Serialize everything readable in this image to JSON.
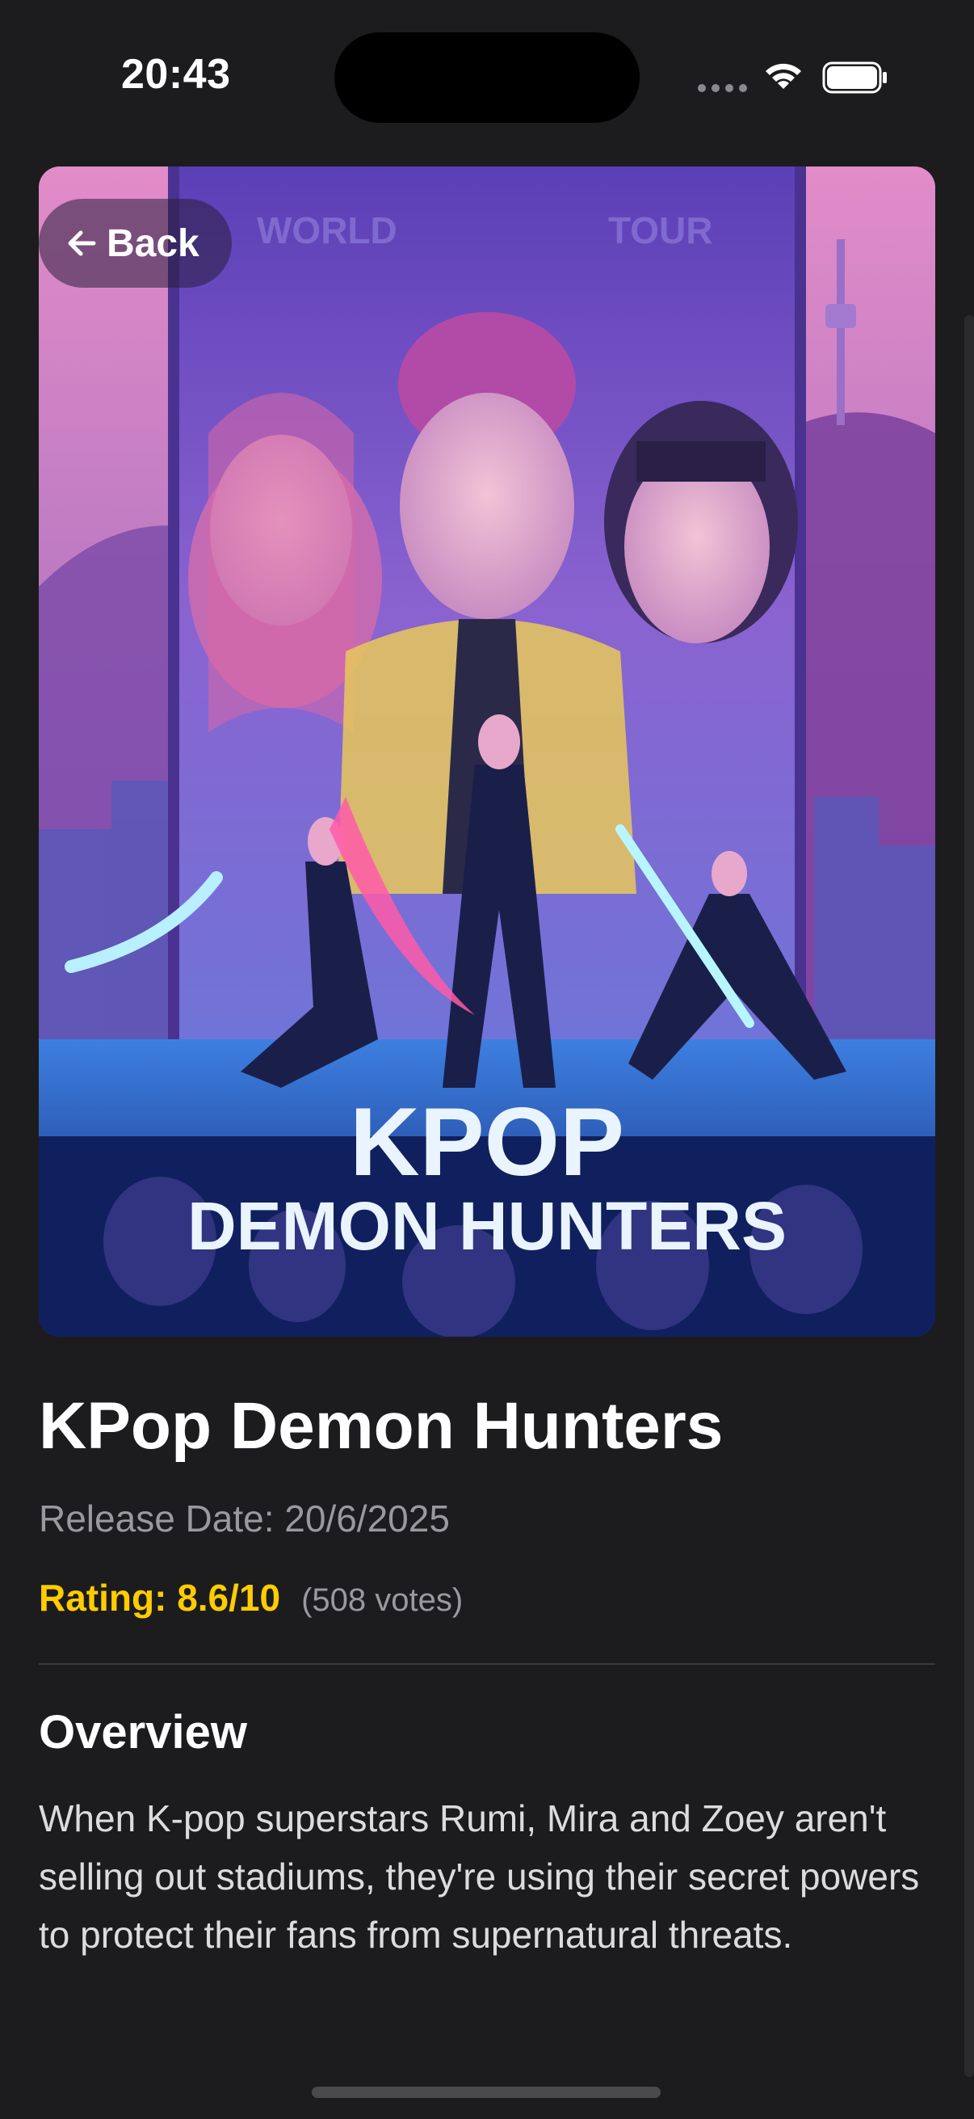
{
  "status_bar": {
    "time": "20:43",
    "wifi_icon": "wifi-icon",
    "battery_icon": "battery-full-icon",
    "signal_icon": "signal-dots-icon"
  },
  "navigation": {
    "back_label": "Back",
    "back_icon": "arrow-left-icon"
  },
  "poster": {
    "logo_line1": "KPOP",
    "logo_line2": "DEMON HUNTERS",
    "banner_left": "WORLD",
    "banner_right": "TOUR"
  },
  "movie": {
    "title": "KPop Demon Hunters",
    "release_date": "Release Date: 20/6/2025",
    "rating": "Rating: 8.6/10",
    "votes": "(508 votes)"
  },
  "overview": {
    "heading": "Overview",
    "text": "When K-pop superstars Rumi, Mira and Zoey aren't selling out stadiums, they're using their secret powers to protect their fans from supernatural threats."
  },
  "colors": {
    "background": "#1c1c1e",
    "rating": "#ffcc00",
    "secondary_text": "#9a9a9e"
  }
}
